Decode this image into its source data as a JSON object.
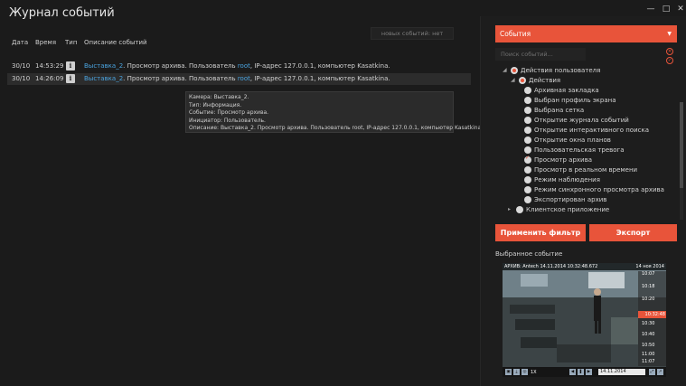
{
  "window": {
    "title": "Журнал событий",
    "minimize": "—",
    "maximize": "□",
    "close": "✕"
  },
  "columns": {
    "date": "Дата",
    "time": "Время",
    "type": "Тип",
    "description": "Описание событий"
  },
  "new_events": "новых событий: нет",
  "events": [
    {
      "date": "30/10",
      "time": "14:53:29",
      "camera": "Выставка_2",
      "text_a": ". Просмотр архива. Пользователь ",
      "user": "root",
      "text_b": ", IP-адрес 127.0.0.1, компьютер Kasatkina."
    },
    {
      "date": "30/10",
      "time": "14:26:09",
      "camera": "Выставка_2",
      "text_a": ". Просмотр архива. Пользователь ",
      "user": "root",
      "text_b": ", IP-адрес 127.0.0.1, компьютер Kasatkina."
    }
  ],
  "tooltip": {
    "lines": [
      "Камера:  Выставка_2.",
      "Тип:  Информация.",
      "Событие:  Просмотр архива.",
      "Инициатор:  Пользователь.",
      "Описание:  Выставка_2. Просмотр архива. Пользователь root, IP-адрес 127.0.0.1, компьютер Kasatkina."
    ]
  },
  "filter": {
    "dropdown_label": "События",
    "search_placeholder": "Поиск событий...",
    "tree": [
      {
        "label": "Действия пользователя",
        "state": "partial",
        "level": 0,
        "expanded": true
      },
      {
        "label": "Действия",
        "state": "partial",
        "level": 1,
        "expanded": true
      },
      {
        "label": "Архивная закладка",
        "state": "none",
        "level": 2
      },
      {
        "label": "Выбран профиль экрана",
        "state": "none",
        "level": 2
      },
      {
        "label": "Выбрана сетка",
        "state": "none",
        "level": 2
      },
      {
        "label": "Открытие журнала событий",
        "state": "none",
        "level": 2
      },
      {
        "label": "Открытие интерактивного поиска",
        "state": "none",
        "level": 2
      },
      {
        "label": "Открытие окна планов",
        "state": "none",
        "level": 2
      },
      {
        "label": "Пользовательская тревога",
        "state": "none",
        "level": 2
      },
      {
        "label": "Просмотр архива",
        "state": "checked",
        "level": 2
      },
      {
        "label": "Просмотр в реальном времени",
        "state": "none",
        "level": 2
      },
      {
        "label": "Режим наблюдения",
        "state": "none",
        "level": 2
      },
      {
        "label": "Режим синхронного просмотра архива",
        "state": "none",
        "level": 2
      },
      {
        "label": "Экспортирован архив",
        "state": "none",
        "level": 2
      },
      {
        "label": "Клиентское приложение",
        "state": "none",
        "level": 1,
        "expanded": false
      }
    ],
    "apply_label": "Применить фильтр",
    "export_label": "Экспорт"
  },
  "selected_event": {
    "title": "Выбранное событие",
    "overlay": "АРХИВ: Antech 14.11.2014 10:32:48.672",
    "date_top": "14 ноя 2014",
    "timeline": [
      "10:07",
      "10:18",
      "10:20",
      "10:30",
      "10:40",
      "10:50",
      "11:00",
      "11:07"
    ],
    "timeline_now": "10:32:48",
    "date_bottom": "14 ноя 2014",
    "speed": "1X",
    "time_field": "14.11.2014 10:32:48"
  },
  "colors": {
    "accent": "#e8543a",
    "link": "#4aa3df",
    "background": "#1b1b1b"
  }
}
